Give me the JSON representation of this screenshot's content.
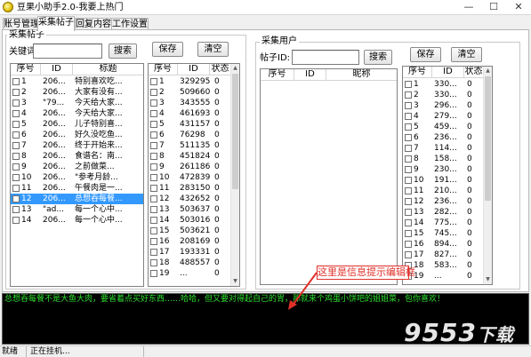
{
  "window": {
    "title": "豆果小助手2.0-我要上热门"
  },
  "tabs": [
    {
      "label": "账号管理",
      "active": false
    },
    {
      "label": "采集帖子",
      "active": true
    },
    {
      "label": "回复内容",
      "active": false
    },
    {
      "label": "工作设置",
      "active": false
    }
  ],
  "collect_posts": {
    "group_title": "采集帖子",
    "keyword_label": "关键词",
    "keyword_value": "",
    "search_button": "搜索",
    "save_button": "保存",
    "clear_button": "清空",
    "posts_list": {
      "headers": [
        "序号",
        "ID",
        "标题"
      ],
      "rows": [
        {
          "no": "1",
          "id": "206...",
          "title": "特别喜欢吃...",
          "checked": false,
          "selected": false
        },
        {
          "no": "2",
          "id": "206...",
          "title": "大家有没有...",
          "checked": false,
          "selected": false
        },
        {
          "no": "3",
          "id": "\"79...",
          "title": "今天给大家...",
          "checked": false,
          "selected": false
        },
        {
          "no": "4",
          "id": "206...",
          "title": "今天给大家...",
          "checked": false,
          "selected": false
        },
        {
          "no": "5",
          "id": "206...",
          "title": "儿子特别喜...",
          "checked": false,
          "selected": false
        },
        {
          "no": "6",
          "id": "206...",
          "title": "好久没吃鱼...",
          "checked": false,
          "selected": false
        },
        {
          "no": "7",
          "id": "206...",
          "title": "终于开始来...",
          "checked": false,
          "selected": false
        },
        {
          "no": "8",
          "id": "206...",
          "title": "食谱名：南...",
          "checked": false,
          "selected": false
        },
        {
          "no": "9",
          "id": "206...",
          "title": "之前做菜...",
          "checked": false,
          "selected": false
        },
        {
          "no": "10",
          "id": "206...",
          "title": "\"参考月龄...",
          "checked": false,
          "selected": false
        },
        {
          "no": "11",
          "id": "206...",
          "title": "午餐肉是一...",
          "checked": false,
          "selected": false
        },
        {
          "no": "12",
          "id": "206...",
          "title": "总想吞每餐...",
          "checked": false,
          "selected": true
        },
        {
          "no": "13",
          "id": "\"ad...",
          "title": "每一个心中...",
          "checked": false,
          "selected": false
        },
        {
          "no": "14",
          "id": "206...",
          "title": "每一个心中...",
          "checked": false,
          "selected": false
        }
      ]
    },
    "status_list": {
      "headers": [
        "序号",
        "ID",
        "状态"
      ],
      "rows": [
        {
          "no": "1",
          "id": "329295",
          "status": "0"
        },
        {
          "no": "2",
          "id": "509660",
          "status": "0"
        },
        {
          "no": "3",
          "id": "343555",
          "status": "0"
        },
        {
          "no": "4",
          "id": "461693",
          "status": "0"
        },
        {
          "no": "5",
          "id": "431157",
          "status": "0"
        },
        {
          "no": "6",
          "id": "76298",
          "status": "0"
        },
        {
          "no": "7",
          "id": "511135",
          "status": "0"
        },
        {
          "no": "8",
          "id": "451824",
          "status": "0"
        },
        {
          "no": "9",
          "id": "261186",
          "status": "0"
        },
        {
          "no": "10",
          "id": "472839",
          "status": "0"
        },
        {
          "no": "11",
          "id": "283150",
          "status": "0"
        },
        {
          "no": "12",
          "id": "432652",
          "status": "0"
        },
        {
          "no": "13",
          "id": "503637",
          "status": "0"
        },
        {
          "no": "14",
          "id": "503016",
          "status": "0"
        },
        {
          "no": "15",
          "id": "503621",
          "status": "0"
        },
        {
          "no": "16",
          "id": "208169",
          "status": "0"
        },
        {
          "no": "17",
          "id": "193331",
          "status": "0"
        },
        {
          "no": "18",
          "id": "488557",
          "status": "0"
        },
        {
          "no": "19",
          "id": "...",
          "status": "0"
        }
      ]
    }
  },
  "collect_users": {
    "group_title": "采集用户",
    "post_id_label": "帖子ID:",
    "post_id_value": "",
    "search_button": "搜索",
    "save_button": "保存",
    "clear_button": "清空",
    "users_list": {
      "headers": [
        "序号",
        "ID",
        "昵称"
      ],
      "rows": []
    },
    "status_list": {
      "headers": [
        "序号",
        "ID",
        "状态"
      ],
      "rows": [
        {
          "no": "1",
          "id": "330...",
          "status": "0"
        },
        {
          "no": "2",
          "id": "330...",
          "status": "0"
        },
        {
          "no": "3",
          "id": "296...",
          "status": "0"
        },
        {
          "no": "4",
          "id": "279...",
          "status": "0"
        },
        {
          "no": "5",
          "id": "459...",
          "status": "0"
        },
        {
          "no": "6",
          "id": "236...",
          "status": "0"
        },
        {
          "no": "7",
          "id": "114...",
          "status": "0"
        },
        {
          "no": "8",
          "id": "158...",
          "status": "0"
        },
        {
          "no": "9",
          "id": "230...",
          "status": "0"
        },
        {
          "no": "10",
          "id": "191...",
          "status": "0"
        },
        {
          "no": "11",
          "id": "210...",
          "status": "0"
        },
        {
          "no": "12",
          "id": "236...",
          "status": "0"
        },
        {
          "no": "13",
          "id": "282...",
          "status": "0"
        },
        {
          "no": "14",
          "id": "775...",
          "status": "0"
        },
        {
          "no": "15",
          "id": "745...",
          "status": "0"
        },
        {
          "no": "16",
          "id": "894...",
          "status": "0"
        },
        {
          "no": "17",
          "id": "827...",
          "status": "0"
        },
        {
          "no": "18",
          "id": "583...",
          "status": "0"
        },
        {
          "no": "19",
          "id": "...",
          "status": "0"
        }
      ]
    }
  },
  "log": {
    "line": "总想吞每餐不是大鱼大肉，要省着点买好东西……哈哈，但又要对得起自己的胃，那就来个鸡蛋小饼吧的姐姐菜，包你喜欢！"
  },
  "annotation": {
    "text": "这里是信息提示编辑框",
    "color": "#e0302a"
  },
  "watermark": {
    "text": "9553下载"
  },
  "statusbar": {
    "cells": [
      "就绪",
      "正在挂机..."
    ]
  },
  "colors": {
    "selection": "#3399ff",
    "log_text": "#2ee02e",
    "log_bg": "#000000"
  }
}
